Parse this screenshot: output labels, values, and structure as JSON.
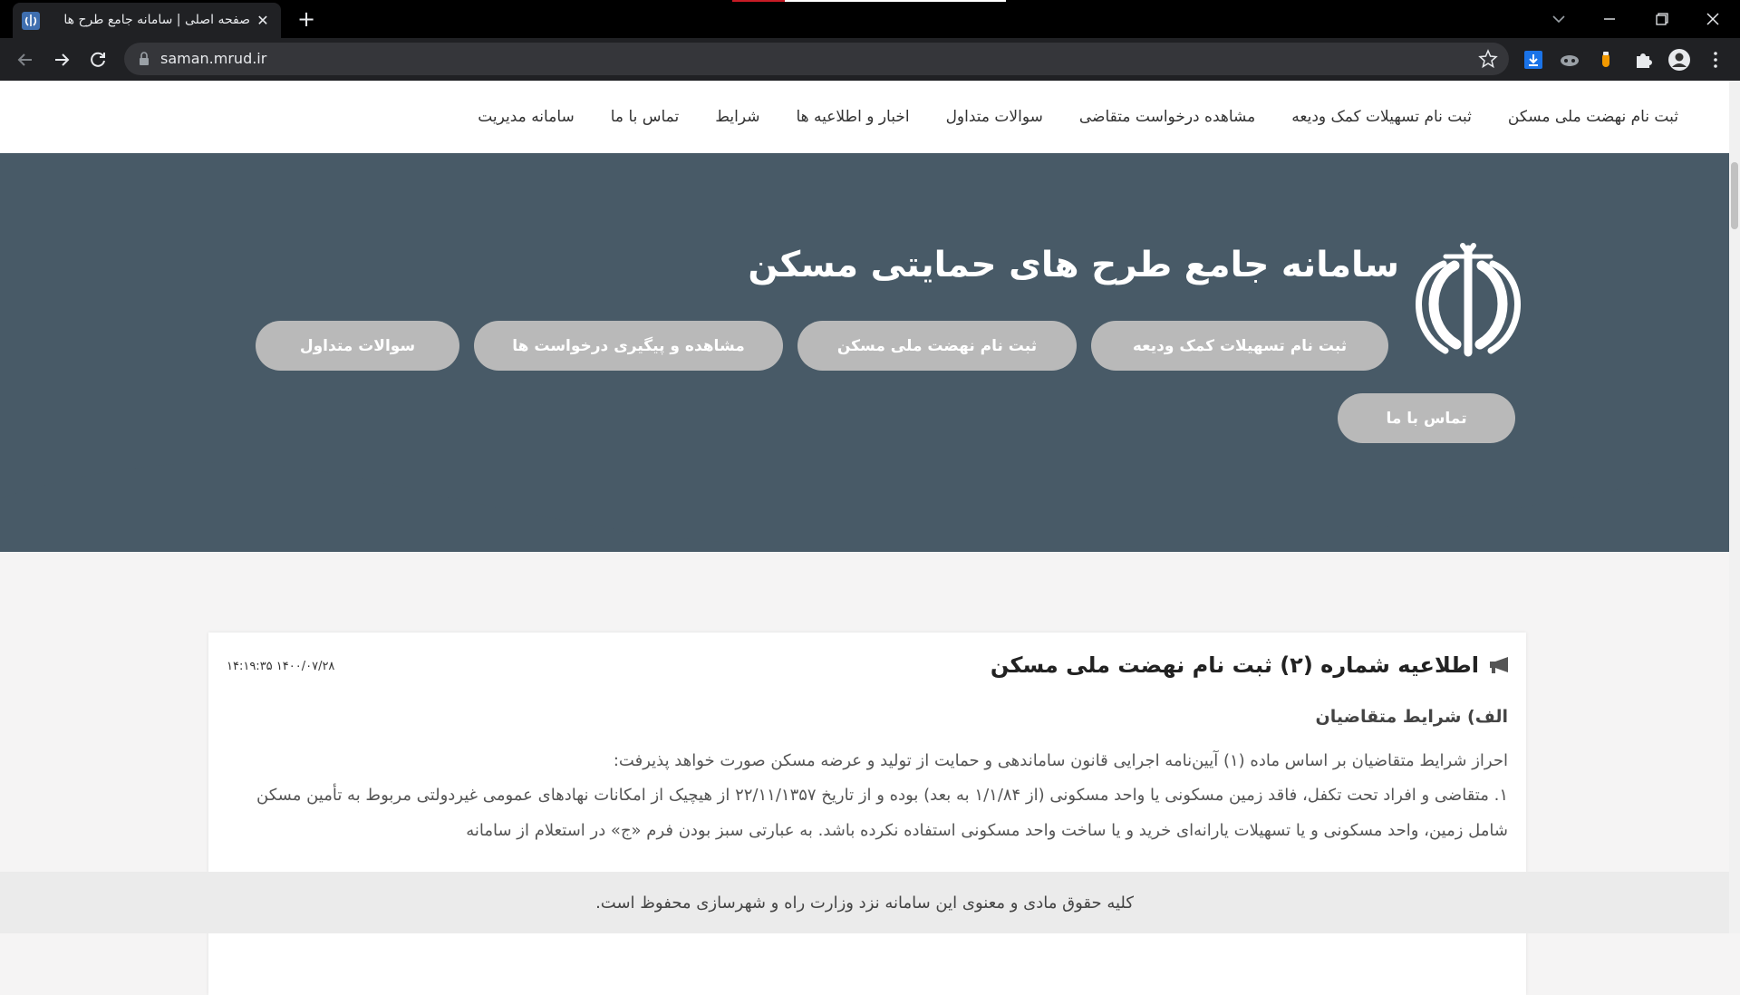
{
  "browser": {
    "tab_title": "صفحه اصلی | سامانه جامع طرح ها",
    "tab_close": "✕",
    "new_tab": "+",
    "url": "saman.mrud.ir"
  },
  "nav": {
    "items": [
      "ثبت نام نهضت ملی مسکن",
      "ثبت نام تسهیلات کمک ودیعه",
      "مشاهده درخواست متقاضی",
      "سوالات متداول",
      "اخبار و اطلاعیه ها",
      "شرایط",
      "تماس با ما",
      "سامانه مدیریت"
    ]
  },
  "hero": {
    "title": "سامانه جامع طرح های حمایتی مسکن",
    "buttons": [
      "ثبت نام تسهیلات کمک ودیعه",
      "ثبت نام نهضت ملی مسکن",
      "مشاهده و پیگیری درخواست ها",
      "سوالات متداول",
      "تماس با ما"
    ]
  },
  "notice": {
    "title": "اطلاعیه شماره (۲) ثبت نام نهضت ملی مسکن",
    "date": "۱۴۰۰/۰۷/۲۸ ۱۴:۱۹:۳۵",
    "section_title": "الف) شرایط متقاضیان",
    "paragraph_1": "احراز شرایط متقاضیان بر اساس ماده (۱) آیین‌نامه اجرایی قانون ساماندهی و حمایت از تولید و عرضه مسکن صورت خواهد پذیرفت:",
    "paragraph_2": "۱. متقاضی و افراد تحت تکفل، فاقد زمین مسکونی یا واحد مسکونی (از ۱/۱/۸۴ به بعد) بوده و از تاریخ ۲۲/۱۱/۱۳۵۷ از هیچیک از امکانات نهادهای عمومی غیردولتی مربوط به تأمین مسکن شامل زمین، واحد مسکونی و یا تسهیلات یارانه‌ای خرید و یا ساخت واحد مسکونی استفاده نکرده باشد. به عبارتی سبز بودن فرم «ج» در استعلام از سامانه"
  },
  "footer": {
    "text": "کلیه حقوق مادی و معنوی این سامانه نزد وزارت راه و شهرسازی محفوظ است."
  },
  "colors": {
    "hero_bg": "#485a67",
    "page_bg": "#f5f4f4",
    "button_bg": "#b9b9b9",
    "footer_bg": "#ebebeb"
  }
}
